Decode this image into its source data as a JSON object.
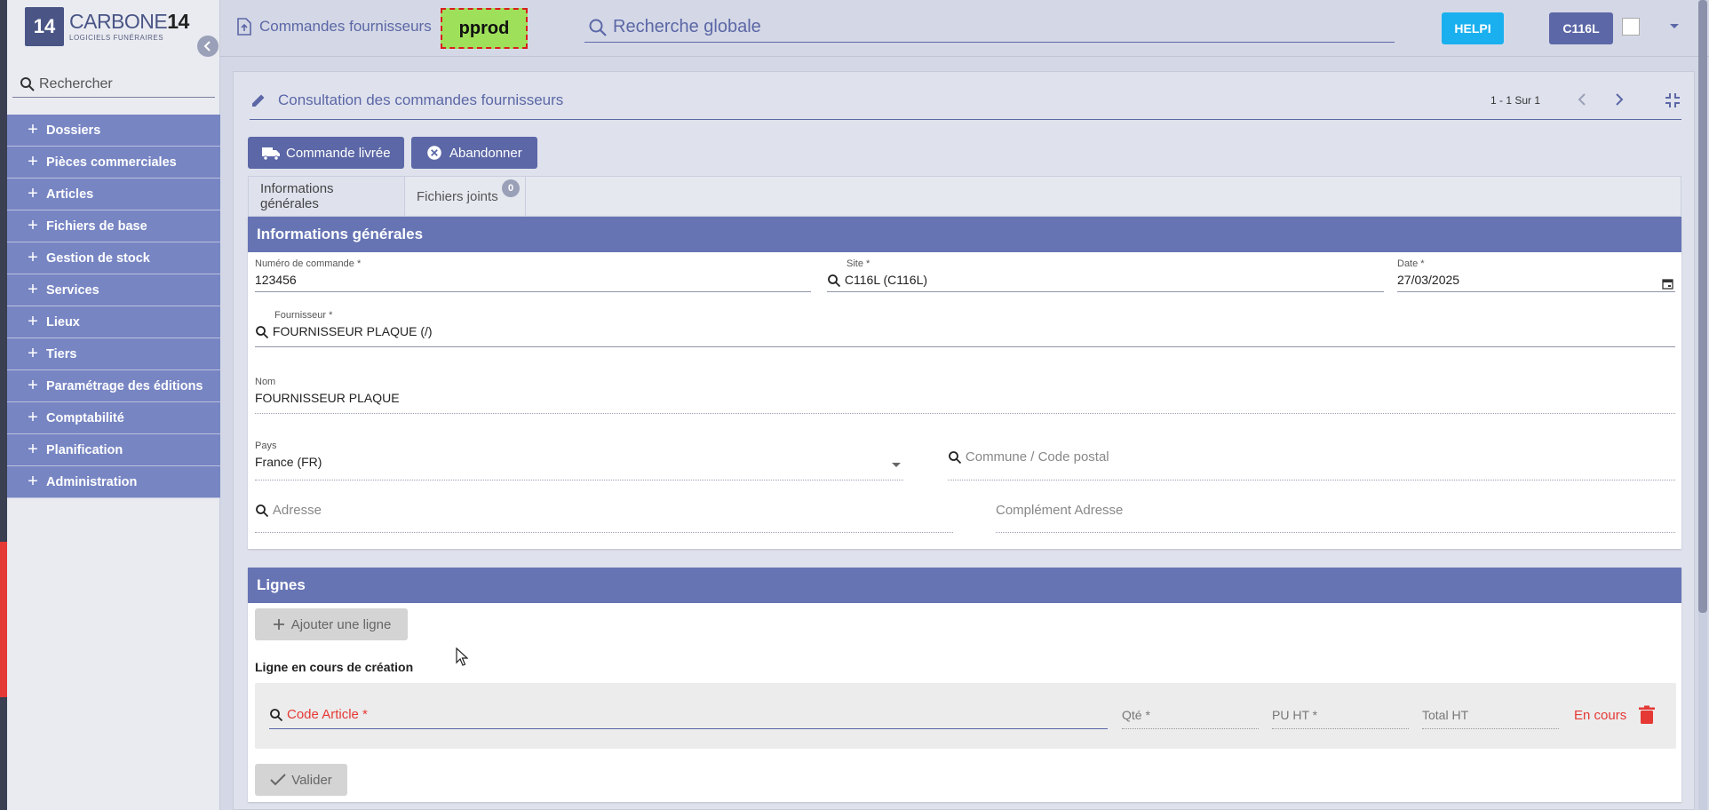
{
  "logo": {
    "name_light": "CARBONE",
    "name_bold": "14",
    "subtitle": "LOGICIELS FUNÉRAIRES",
    "mark": "14"
  },
  "sidebar": {
    "search_placeholder": "Rechercher",
    "items": [
      {
        "label": "Dossiers"
      },
      {
        "label": "Pièces commerciales"
      },
      {
        "label": "Articles"
      },
      {
        "label": "Fichiers de base"
      },
      {
        "label": "Gestion de stock"
      },
      {
        "label": "Services"
      },
      {
        "label": "Lieux"
      },
      {
        "label": "Tiers"
      },
      {
        "label": "Paramétrage des éditions"
      },
      {
        "label": "Comptabilité"
      },
      {
        "label": "Planification"
      },
      {
        "label": "Administration"
      }
    ]
  },
  "header": {
    "page_label": "Commandes fournisseurs",
    "env_badge": "pprod",
    "search_placeholder": "Recherche globale",
    "helpi_label": "HELPI",
    "user_label": "C116L"
  },
  "main": {
    "title": "Consultation des commandes fournisseurs",
    "pager": "1 - 1 Sur 1",
    "actions": {
      "delivered_label": "Commande livrée",
      "abandon_label": "Abandonner"
    },
    "tabs": [
      {
        "label": "Informations générales"
      },
      {
        "label": "Fichiers joints",
        "badge": "0"
      }
    ],
    "info_panel": {
      "heading": "Informations générales",
      "order_number": {
        "label": "Numéro de commande *",
        "value": "123456"
      },
      "site": {
        "label": "Site *",
        "value": "C116L (C116L)"
      },
      "date": {
        "label": "Date *",
        "value": "27/03/2025"
      },
      "supplier": {
        "label": "Fournisseur *",
        "value": "FOURNISSEUR PLAQUE (/)"
      },
      "name": {
        "label": "Nom",
        "value": "FOURNISSEUR PLAQUE"
      },
      "country": {
        "label": "Pays",
        "value": "France (FR)"
      },
      "city_placeholder": "Commune / Code postal",
      "address_placeholder": "Adresse",
      "address2_placeholder": "Complément Adresse"
    },
    "lines_panel": {
      "heading": "Lignes",
      "add_line_label": "Ajouter une ligne",
      "creation_title": "Ligne en cours de création",
      "code_placeholder": "Code Article *",
      "qty_placeholder": "Qté *",
      "unit_price_placeholder": "PU HT *",
      "total_placeholder": "Total HT",
      "status": "En cours",
      "validate_label": "Valider"
    }
  },
  "colors": {
    "primary": "#5b67a6",
    "menu": "#7785c3",
    "panel_header": "#6674b4",
    "env_badge": "#9ee05a",
    "helpi": "#1ab0ef",
    "error": "#e53935"
  }
}
